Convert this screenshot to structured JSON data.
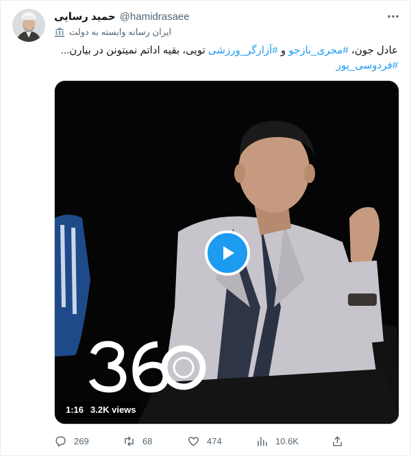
{
  "author": {
    "display_name": "حمید رسایی",
    "handle": "@hamidrasaee",
    "label": "ایران رسانه وابسته به دولت",
    "avatar_icon": "avatar-cleric-photo"
  },
  "tweet": {
    "text_part1": "عادل جون، ",
    "hashtag1": "#مجری_بازجو",
    "text_part2": " و ",
    "hashtag2": "#آزارگر_ورزشی",
    "text_part3": " تویی، بقیه اداتم نمیتونن در بیارن...",
    "hashtag3": "#فردوسی_پور"
  },
  "media": {
    "duration": "1:16",
    "views": "3.2K views",
    "watermark_logo": "360",
    "play_icon": "play-icon"
  },
  "actions": {
    "replies": "269",
    "retweets": "68",
    "likes": "474",
    "views": "10.6K"
  },
  "colors": {
    "accent": "#1d9bf0",
    "text": "#0f1419",
    "secondary": "#536471"
  }
}
